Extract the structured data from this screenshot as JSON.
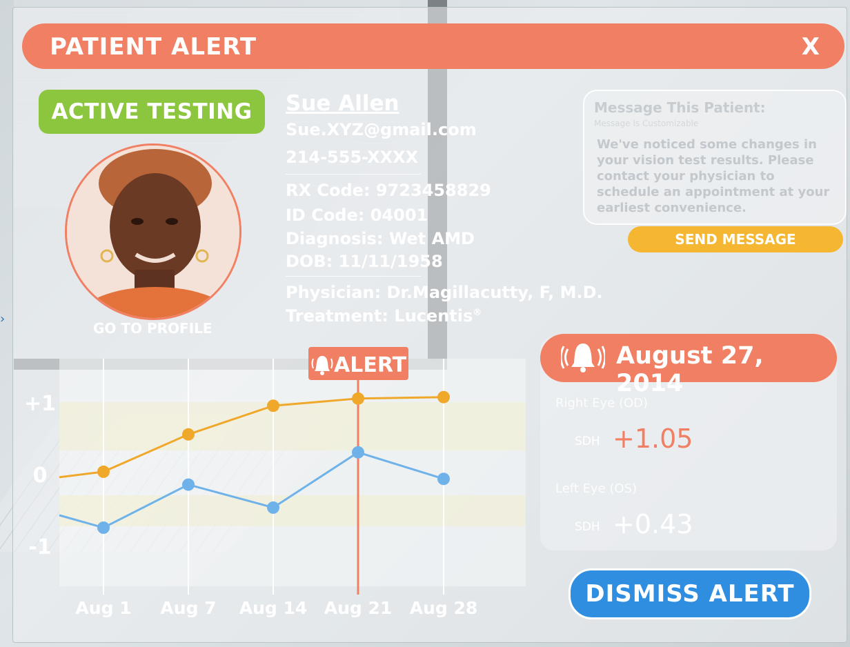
{
  "header": {
    "title": "PATIENT ALERT",
    "close_label": "X"
  },
  "status_badge": "ACTIVE TESTING",
  "profile_link": "GO TO PROFILE",
  "patient": {
    "name": "Sue Allen",
    "email": "Sue.XYZ@gmail.com",
    "phone": "214-555-XXXX",
    "rx_code": "RX Code:  9723458829",
    "id_code": "ID Code: 04001",
    "diagnosis": "Diagnosis: Wet AMD",
    "dob": "DOB: 11/11/1958",
    "physician": "Physician: Dr.Magillacutty, F, M.D.",
    "treatment": "Treatment: Lucentis",
    "treatment_mark": "®"
  },
  "message": {
    "title": "Message This Patient:",
    "subtitle": "Message Is Customizable",
    "body": "We've noticed some changes in your vision test results. Please contact your physician to schedule an appointment at your earliest convenience.",
    "send_label": "SEND MESSAGE"
  },
  "alert_date": "August 27, 2014",
  "right_eye": {
    "label": "Right Eye (OD)",
    "metric": "SDH",
    "value": "+1.05"
  },
  "left_eye": {
    "label": "Left Eye (OS)",
    "metric": "SDH",
    "value": "+0.43"
  },
  "dismiss_label": "DISMISS ALERT",
  "colors": {
    "accent": "#f07f63",
    "active": "#8cc63f",
    "send": "#f5b731",
    "dismiss": "#2f8ee0",
    "series_orange": "#f0a82a",
    "series_blue": "#6fb2ea"
  },
  "chart_data": {
    "type": "line",
    "categories": [
      "Aug 1",
      "Aug 7",
      "Aug 14",
      "Aug 21",
      "Aug 28"
    ],
    "y_tick_labels": [
      "+1",
      "0",
      "-1"
    ],
    "alert_label": "ALERT",
    "alert_category": "Aug 21",
    "ylim": [
      -1,
      1
    ],
    "series": [
      {
        "color": "#f0a82a",
        "values": [
          0.03,
          0.55,
          0.95,
          1.05,
          1.07
        ]
      },
      {
        "color": "#6fb2ea",
        "values": [
          -0.75,
          -0.15,
          -0.47,
          0.3,
          -0.07
        ]
      }
    ]
  }
}
